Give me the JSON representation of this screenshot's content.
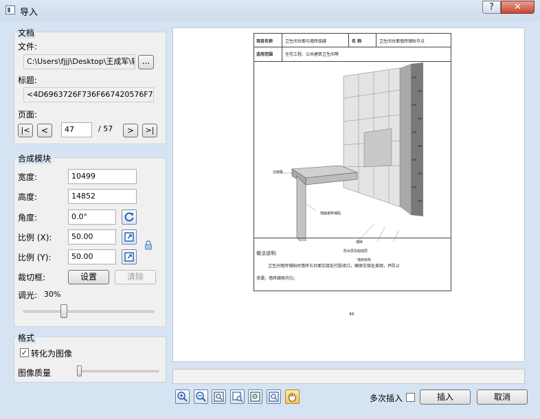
{
  "window": {
    "title": "导入",
    "help": "?",
    "close": "✕"
  },
  "document_group": {
    "title": "文档",
    "file_label": "文件:",
    "file_value": "C:\\Users\\fjjj\\Desktop\\王成军\\辅",
    "browse_label": "...",
    "heading_label": "标题:",
    "heading_value": "<4D6963726F736F667420576F72642",
    "page_label": "页面:",
    "first": "|<",
    "prev": "<",
    "page_value": "47",
    "page_total": "/ 57",
    "next": ">",
    "last": ">|"
  },
  "compose_group": {
    "title": "合成模块",
    "width_label": "宽度:",
    "width_value": "10499",
    "height_label": "高度:",
    "height_value": "14852",
    "angle_label": "角度:",
    "angle_value": "0.0°",
    "scale_x_label": "比例 (X):",
    "scale_x_value": "50.00",
    "scale_y_label": "比例 (Y):",
    "scale_y_value": "50.00",
    "crop_label": "裁切框:",
    "set_label": "设置",
    "clear_label": "清除",
    "dim_label": "调光:",
    "dim_value": "30%",
    "dim_fraction": 0.3
  },
  "format_group": {
    "title": "格式",
    "convert_label": "转化为图像",
    "convert_checked": "✓",
    "quality_label": "图像质量",
    "quality_fraction": 0.0
  },
  "preview_doc": {
    "hdr_project_label": "项目名称",
    "hdr_project_value": "卫生间台面与墙砖接缝",
    "hdr_name_label": "名    称",
    "hdr_name_value": "卫生间台面墙砖铺贴节点",
    "hdr_scope_label": "适用范围",
    "hdr_scope_value": "住宅工程、公共建筑卫生间等",
    "callout_1": "台面板",
    "callout_2": "墙面瓷砖铺贴",
    "callout_3": "墙砖",
    "callout_4": "防水层及粘结层",
    "callout_5": "墙体结构",
    "notes_title": "做法说明:",
    "notes_line_1": "卫生间墙砖铺贴时墙砖与台面交接处打胶收口，确保交接处美观，并防止",
    "notes_line_2": "渗漏，墙砖缝隙均匀。",
    "page_number": "46"
  },
  "footer": {
    "tools": [
      "zoom-in-icon",
      "zoom-out-icon",
      "fit-page-icon",
      "fit-width-icon",
      "fit-height-icon",
      "actual-size-icon",
      "hand-icon"
    ],
    "multi_insert_label": "多次插入",
    "insert_label": "插入",
    "cancel_label": "取消"
  }
}
